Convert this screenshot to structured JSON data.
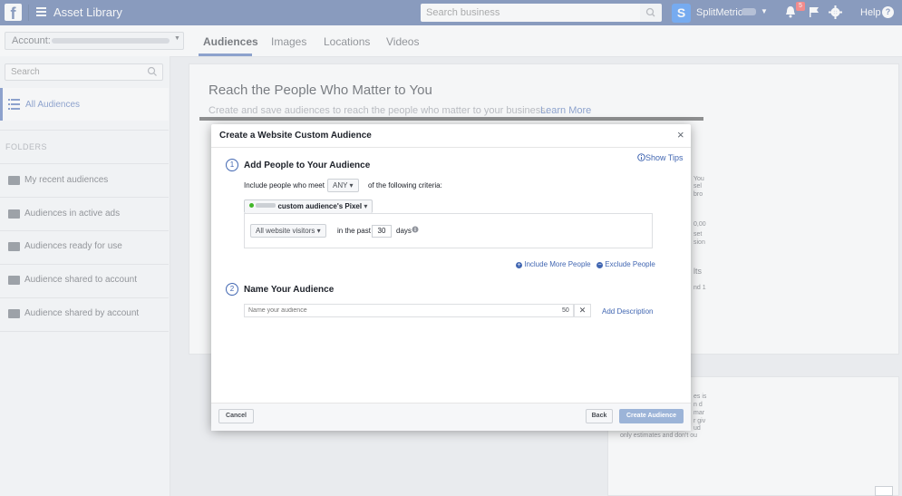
{
  "topbar": {
    "logo": "f",
    "app_title": "Asset Library",
    "search_placeholder": "Search business",
    "brand_icon": "S",
    "brand_name": "SplitMetrics",
    "notification_count": "5",
    "help_label": "Help",
    "help_icon": "?"
  },
  "account": {
    "label": "Account:"
  },
  "tabs": [
    {
      "label": "Audiences",
      "active": true
    },
    {
      "label": "Images"
    },
    {
      "label": "Locations"
    },
    {
      "label": "Videos"
    }
  ],
  "sidebar": {
    "search_placeholder": "Search",
    "all_audiences": "All Audiences",
    "folders_heading": "FOLDERS",
    "folders": [
      {
        "label": "My recent audiences"
      },
      {
        "label": "Audiences in active ads"
      },
      {
        "label": "Audiences ready for use"
      },
      {
        "label": "Audience shared to account"
      },
      {
        "label": "Audience shared by account"
      }
    ]
  },
  "main": {
    "title": "Reach the People Who Matter to You",
    "subtitle": "Create and save audiences to reach the people who matter to your business.",
    "learn_more": "Learn More",
    "right_fragments": [
      "You",
      "sel",
      "bro",
      "0,00",
      "set",
      "sion",
      "lts",
      "nd 1"
    ],
    "lower_fragments": [
      "es is",
      "n d",
      "mar",
      "r giv",
      "ud",
      "only estimates and don't ou"
    ]
  },
  "modal": {
    "title": "Create a Website Custom Audience",
    "close_icon": "×",
    "show_tips": "Show Tips",
    "step1": {
      "number": "1",
      "title": "Add People to Your Audience",
      "include_prefix": "Include people who meet",
      "any_value": "ANY",
      "include_suffix": "of the following criteria:",
      "pixel_label": "custom audience's Pixel",
      "visitors_value": "All website visitors",
      "in_the_past": "in the past",
      "days_value": "30",
      "days_label": "days",
      "include_more": "Include More People",
      "exclude": "Exclude People"
    },
    "step2": {
      "number": "2",
      "title": "Name Your Audience",
      "name_placeholder": "Name your audience",
      "char_count": "50",
      "clear_icon": "✕",
      "add_description": "Add Description"
    },
    "footer": {
      "cancel": "Cancel",
      "back": "Back",
      "create": "Create Audience"
    }
  }
}
